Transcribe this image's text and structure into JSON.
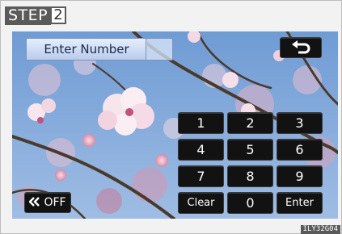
{
  "step": {
    "label": "STEP",
    "number": "2"
  },
  "header": {
    "title": "Enter Number",
    "input_value": ""
  },
  "buttons": {
    "back_icon": "return-arrow-icon",
    "off_label": "OFF",
    "off_icon": "double-chevron-left-icon"
  },
  "keypad": {
    "keys": [
      "1",
      "2",
      "3",
      "4",
      "5",
      "6",
      "7",
      "8",
      "9",
      "Clear",
      "0",
      "Enter"
    ]
  },
  "caption": "ILY32G04",
  "colors": {
    "button": "#121212",
    "title_box": "#c9d8f2",
    "sky": "#7fa8d8",
    "blossom": "#f4d2dc"
  }
}
